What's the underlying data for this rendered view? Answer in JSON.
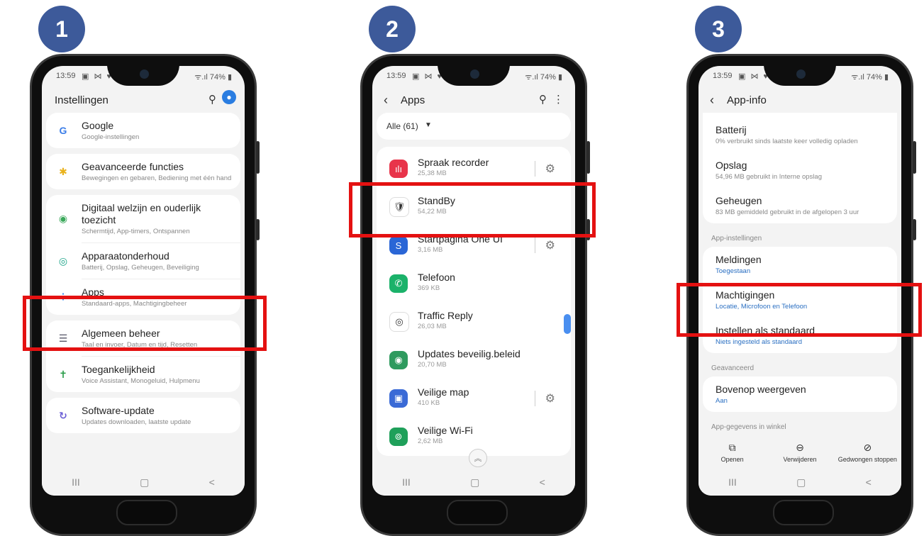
{
  "steps": [
    "1",
    "2",
    "3"
  ],
  "status": {
    "time": "13:59",
    "sys_icons": "▣ ⋈ ♥ •",
    "signal": "ᯤ.ıl 74% ▮"
  },
  "nav": {
    "recent": "III",
    "home": "▢",
    "back": "<"
  },
  "screen1": {
    "title": "Instellingen",
    "items": [
      {
        "title": "Google",
        "sub": "Google-instellingen",
        "icon": "google-icon",
        "color": "#3b7de8",
        "glyph": "G"
      },
      {
        "title": "Geavanceerde functies",
        "sub": "Bewegingen en gebaren, Bediening met één hand",
        "icon": "gear-icon",
        "color": "#e9b21c",
        "glyph": "✱"
      },
      {
        "title": "Digitaal welzijn en ouderlijk toezicht",
        "sub": "Schermtijd, App-timers, Ontspannen",
        "icon": "wellbeing-icon",
        "color": "#3aa85a",
        "glyph": "◉"
      },
      {
        "title": "Apparaatonderhoud",
        "sub": "Batterij, Opslag, Geheugen, Beveiliging",
        "icon": "care-icon",
        "color": "#1aa387",
        "glyph": "◎"
      },
      {
        "title": "Apps",
        "sub": "Standaard-apps, Machtigingbeheer",
        "icon": "apps-icon",
        "color": "#4a8ff0",
        "glyph": "⁘"
      },
      {
        "title": "Algemeen beheer",
        "sub": "Taal en invoer, Datum en tijd, Resetten",
        "icon": "sliders-icon",
        "color": "#556",
        "glyph": "☰"
      },
      {
        "title": "Toegankelijkheid",
        "sub": "Voice Assistant, Monogeluid, Hulpmenu",
        "icon": "accessibility-icon",
        "color": "#2a9d4a",
        "glyph": "✝"
      },
      {
        "title": "Software-update",
        "sub": "Updates downloaden, laatste update",
        "icon": "update-icon",
        "color": "#6b5fd6",
        "glyph": "↻"
      }
    ]
  },
  "screen2": {
    "title": "Apps",
    "filter": "Alle (61)",
    "apps": [
      {
        "name": "Spraak recorder",
        "size": "25,38 MB",
        "color": "#e8344a",
        "glyph": "ılı",
        "gear": true
      },
      {
        "name": "StandBy",
        "size": "54,22 MB",
        "color": "#ffffff",
        "glyph": "🛡",
        "gear": false
      },
      {
        "name": "Startpagina One UI",
        "size": "3,16 MB",
        "color": "#2a66d6",
        "glyph": "S",
        "gear": true
      },
      {
        "name": "Telefoon",
        "size": "369 KB",
        "color": "#1bb26a",
        "glyph": "✆",
        "gear": false
      },
      {
        "name": "Traffic Reply",
        "size": "26,03 MB",
        "color": "#ffffff",
        "glyph": "◎",
        "gear": false
      },
      {
        "name": "Updates beveilig.beleid",
        "size": "20,70 MB",
        "color": "#2e9a5e",
        "glyph": "◉",
        "gear": false
      },
      {
        "name": "Veilige map",
        "size": "410 KB",
        "color": "#3a6ad6",
        "glyph": "▣",
        "gear": true
      },
      {
        "name": "Veilige Wi-Fi",
        "size": "2,62 MB",
        "color": "#1fa05a",
        "glyph": "⊚",
        "gear": false
      }
    ]
  },
  "screen3": {
    "title": "App-info",
    "group1": [
      {
        "title": "Batterij",
        "sub": "0% verbruikt sinds laatste keer volledig opladen"
      },
      {
        "title": "Opslag",
        "sub": "54,96 MB gebruikt in Interne opslag"
      },
      {
        "title": "Geheugen",
        "sub": "83 MB gemiddeld gebruikt in de afgelopen 3 uur"
      }
    ],
    "section1": "App-instellingen",
    "group2": [
      {
        "title": "Meldingen",
        "sub": "Toegestaan"
      },
      {
        "title": "Machtigingen",
        "sub": "Locatie, Microfoon en Telefoon"
      },
      {
        "title": "Instellen als standaard",
        "sub": "Niets ingesteld als standaard"
      }
    ],
    "section2": "Geavanceerd",
    "group3": [
      {
        "title": "Bovenop weergeven",
        "sub": "Aan"
      }
    ],
    "section3": "App-gegevens in winkel",
    "actions": [
      {
        "label": "Openen",
        "icon": "open-icon",
        "glyph": "⧉"
      },
      {
        "label": "Verwijderen",
        "icon": "remove-icon",
        "glyph": "⊖"
      },
      {
        "label": "Gedwongen stoppen",
        "icon": "stop-icon",
        "glyph": "⊘"
      }
    ]
  },
  "colors": {
    "highlight": "#e41111",
    "badge": "#3d5a9a",
    "link": "#2a6fc2"
  }
}
